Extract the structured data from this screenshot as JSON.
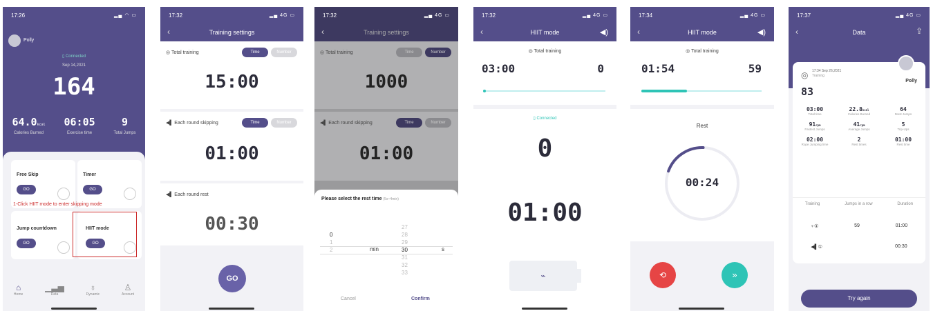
{
  "p1": {
    "time": "17:26",
    "user": "Polly",
    "connected": "Connected",
    "date": "Sep 14,2021",
    "count": "164",
    "stats": [
      {
        "val": "64.0",
        "unit": "kcal",
        "label": "Calories Burned"
      },
      {
        "val": "06:05",
        "label": "Exercise time"
      },
      {
        "val": "9",
        "label": "Total Jumps"
      }
    ],
    "cards": [
      {
        "title": "Free Skip",
        "go": "GO"
      },
      {
        "title": "Timer",
        "go": "GO"
      },
      {
        "title": "Jump countdown",
        "go": "GO"
      },
      {
        "title": "HIIT mode",
        "go": "GO"
      }
    ],
    "annotation": "1-Click HIIT mode to enter skipping mode",
    "nav": [
      {
        "label": "Home"
      },
      {
        "label": "Data"
      },
      {
        "label": "Dynamic"
      },
      {
        "label": "Account"
      }
    ]
  },
  "p2": {
    "time": "17:32",
    "title": "Training settings",
    "total": "Total training",
    "time_btn": "Time",
    "number_btn": "Number",
    "total_val": "15:00",
    "round": "Each round skipping",
    "round_val": "01:00",
    "rest": "Each round rest",
    "rest_val": "00:30",
    "go": "GO"
  },
  "p3": {
    "time": "17:32",
    "title": "Training settings",
    "total": "Total training",
    "time_btn": "Time",
    "number_btn": "Number",
    "total_val": "1000",
    "round": "Each round skipping",
    "round_val": "01:00",
    "sheet_title": "Please select the rest time",
    "sheet_hint": "(5s~4min)",
    "min_col": [
      "",
      "0",
      "1",
      "2"
    ],
    "min_label": "min",
    "sec_col": [
      "27",
      "28",
      "29",
      "30",
      "31",
      "32",
      "33"
    ],
    "s_label": "s",
    "cancel": "Cancel",
    "confirm": "Confirm"
  },
  "p4": {
    "time": "17:32",
    "title": "HIIT mode",
    "total": "Total training",
    "time_val": "03:00",
    "count": "0",
    "connected": "Connected",
    "big": "0",
    "round_time": "01:00",
    "progress": 0.02
  },
  "p5": {
    "time": "17:34",
    "title": "HIIT mode",
    "total": "Total training",
    "time_val": "01:54",
    "count": "59",
    "rest": "Rest",
    "timer": "00:24",
    "progress": 0.38,
    "ring": 0.2
  },
  "p6": {
    "time": "17:37",
    "title": "Data",
    "datetime": "17:34 Sep 26,2021",
    "sub": "Training",
    "count": "83",
    "user": "Polly",
    "grid": [
      {
        "v": "03:00",
        "l": "Total time"
      },
      {
        "v": "22.8",
        "u": "kcal",
        "l": "Calories Burned"
      },
      {
        "v": "64",
        "l": "Most Jumps"
      },
      {
        "v": "91",
        "u": "rpm",
        "l": "Fastest Jumps"
      },
      {
        "v": "41",
        "u": "rpm",
        "l": "Average Jumps"
      },
      {
        "v": "5",
        "l": "Trip-Ups"
      },
      {
        "v": "02:00",
        "l": "Rope Jumping time"
      },
      {
        "v": "2",
        "l": "Rest times"
      },
      {
        "v": "01:00",
        "l": "Rest time"
      }
    ],
    "thead": [
      "Training",
      "Jumps in a row",
      "Duration"
    ],
    "rows": [
      {
        "n": "①",
        "jumps": "59",
        "dur": "01:00"
      },
      {
        "n": "①",
        "jumps": "",
        "dur": "00:30"
      }
    ],
    "try": "Try again"
  },
  "colors": {
    "purple": "#544e8a",
    "teal": "#2ec4b6",
    "red": "#e64545",
    "annot": "#cc2a2a"
  }
}
